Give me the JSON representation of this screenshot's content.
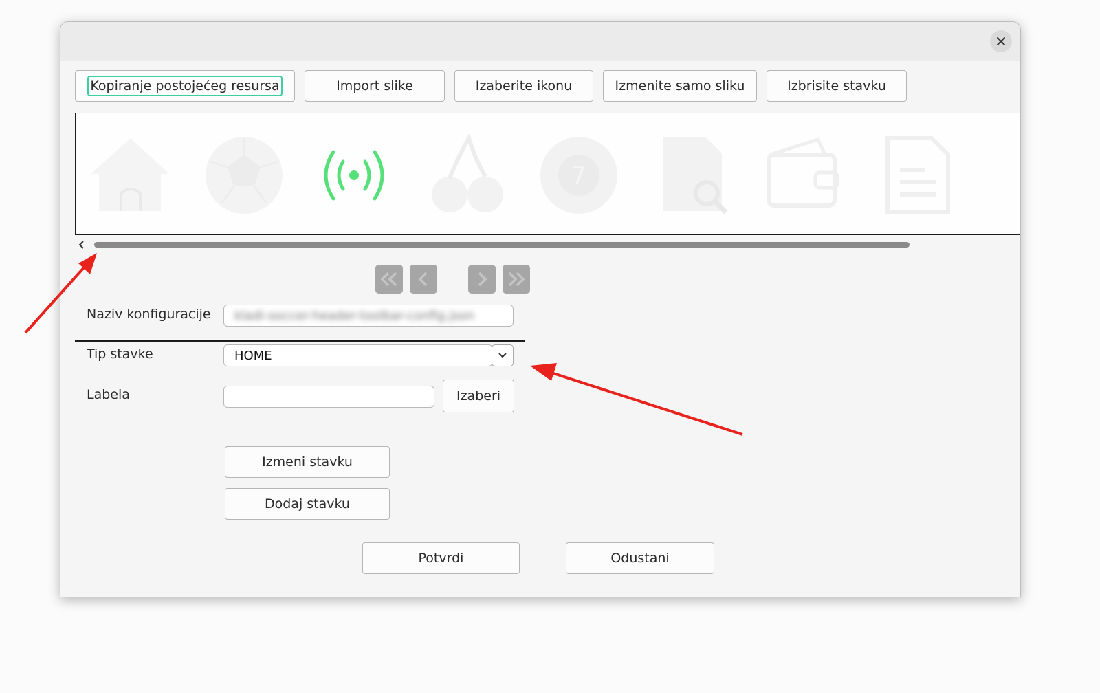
{
  "toolbar": {
    "copy_resource": "Kopiranje postojećeg resursa",
    "import_image": "Import slike",
    "choose_icon": "Izaberite ikonu",
    "change_image_only": "Izmenite samo sliku",
    "delete_item": "Izbrisite stavku"
  },
  "icons": [
    "home-icon",
    "soccer-ball-icon",
    "broadcast-icon",
    "cherry-icon",
    "lottery-ball-icon",
    "document-search-icon",
    "wallet-icon",
    "document-icon"
  ],
  "colors": {
    "selected_icon": "#56e07a",
    "focus_ring": "#3cd0a0",
    "annotation_arrow": "#e8231e"
  },
  "form": {
    "config_name_label": "Naziv konfiguracije",
    "config_name_value": "kladi-soccer-header-toolbar-config.json",
    "item_type_label": "Tip stavke",
    "item_type_value": "HOME",
    "label_label": "Labela",
    "label_value": "",
    "choose_button": "Izaberi"
  },
  "actions": {
    "edit_item": "Izmeni stavku",
    "add_item": "Dodaj stavku",
    "confirm": "Potvrdi",
    "cancel": "Odustani"
  }
}
